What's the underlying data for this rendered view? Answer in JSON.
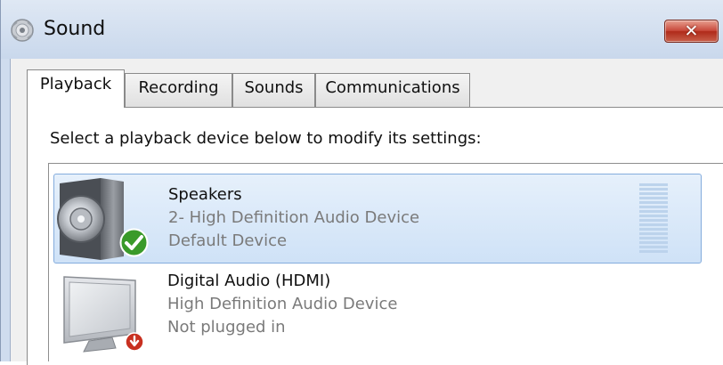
{
  "window": {
    "title": "Sound",
    "close_label": "✕"
  },
  "tabs": [
    {
      "label": "Playback",
      "selected": true
    },
    {
      "label": "Recording",
      "selected": false
    },
    {
      "label": "Sounds",
      "selected": false
    },
    {
      "label": "Communications",
      "selected": false
    }
  ],
  "playback": {
    "instruction": "Select a playback device below to modify its settings:",
    "devices": [
      {
        "name": "Speakers",
        "line1": "2- High Definition Audio Device",
        "line2": "Default Device",
        "icon": "speaker-icon",
        "status_icon": "default-device-check-icon",
        "selected": true
      },
      {
        "name": "Digital Audio (HDMI)",
        "line1": "High Definition Audio Device",
        "line2": "Not plugged in",
        "icon": "monitor-icon",
        "status_icon": "not-plugged-in-icon",
        "selected": false
      }
    ]
  },
  "colors": {
    "selection_border": "#84acdd",
    "selection_fill": "#dce9f8",
    "secondary_text": "#7a7a7a",
    "close_button": "#c8483a",
    "default_check": "#3a9a2a",
    "not_plugged_badge": "#c83020"
  }
}
